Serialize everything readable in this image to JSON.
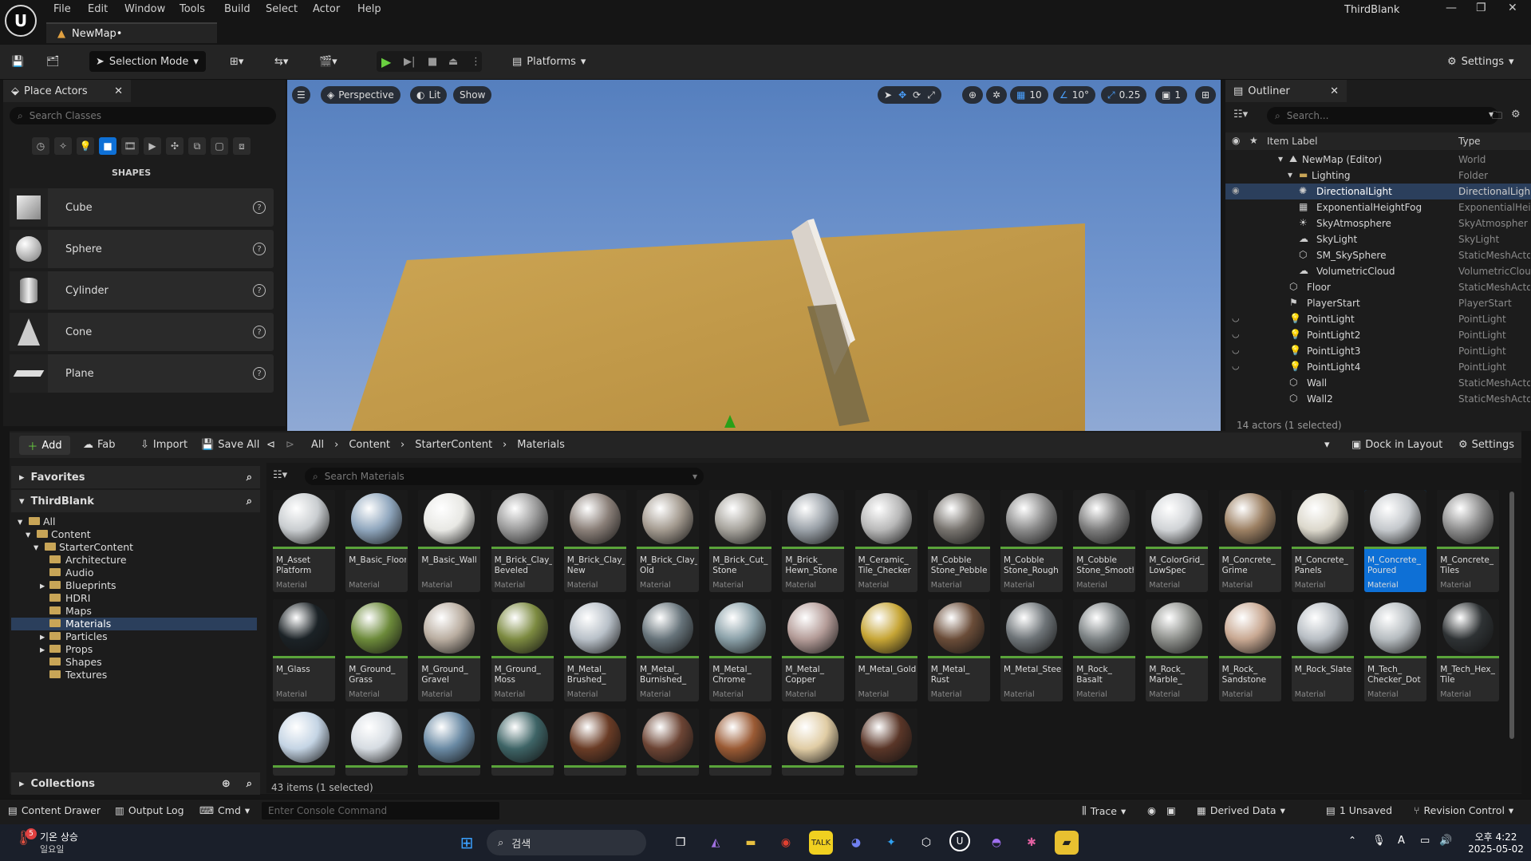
{
  "window": {
    "project": "ThirdBlank",
    "doc_tab": "NewMap•",
    "menus": [
      "File",
      "Edit",
      "Window",
      "Tools",
      "Build",
      "Select",
      "Actor",
      "Help"
    ]
  },
  "toolbar": {
    "selection_mode": "Selection Mode",
    "platforms": "Platforms",
    "settings": "Settings"
  },
  "place_actors": {
    "tab": "Place Actors",
    "search_placeholder": "Search Classes",
    "section": "SHAPES",
    "shapes": [
      "Cube",
      "Sphere",
      "Cylinder",
      "Cone",
      "Plane"
    ]
  },
  "viewport": {
    "perspective": "Perspective",
    "lit": "Lit",
    "show": "Show",
    "grid_snap": "10",
    "rot_snap": "10°",
    "scale_snap": "0.25",
    "camera_speed": "1"
  },
  "outliner": {
    "tab": "Outliner",
    "search_placeholder": "Search...",
    "col_label": "Item Label",
    "col_type": "Type",
    "rows": [
      {
        "label": "NewMap (Editor)",
        "type": "World"
      },
      {
        "label": "Lighting",
        "type": "Folder"
      },
      {
        "label": "DirectionalLight",
        "type": "DirectionalLigh"
      },
      {
        "label": "ExponentialHeightFog",
        "type": "ExponentialHei"
      },
      {
        "label": "SkyAtmosphere",
        "type": "SkyAtmospher"
      },
      {
        "label": "SkyLight",
        "type": "SkyLight"
      },
      {
        "label": "SM_SkySphere",
        "type": "StaticMeshActo"
      },
      {
        "label": "VolumetricCloud",
        "type": "VolumetricClou"
      },
      {
        "label": "Floor",
        "type": "StaticMeshActo"
      },
      {
        "label": "PlayerStart",
        "type": "PlayerStart"
      },
      {
        "label": "PointLight",
        "type": "PointLight"
      },
      {
        "label": "PointLight2",
        "type": "PointLight"
      },
      {
        "label": "PointLight3",
        "type": "PointLight"
      },
      {
        "label": "PointLight4",
        "type": "PointLight"
      },
      {
        "label": "Wall",
        "type": "StaticMeshActo"
      },
      {
        "label": "Wall2",
        "type": "StaticMeshActo"
      }
    ],
    "status": "14 actors (1 selected)"
  },
  "content_browser": {
    "add": "Add",
    "fab": "Fab",
    "import": "Import",
    "save_all": "Save All",
    "breadcrumb": [
      "All",
      "Content",
      "StarterContent",
      "Materials"
    ],
    "dock": "Dock in Layout",
    "settings": "Settings",
    "favorites": "Favorites",
    "project": "ThirdBlank",
    "collections": "Collections",
    "search_placeholder": "Search Materials",
    "tree": [
      {
        "label": "All"
      },
      {
        "label": "Content"
      },
      {
        "label": "StarterContent"
      },
      {
        "label": "Architecture"
      },
      {
        "label": "Audio"
      },
      {
        "label": "Blueprints"
      },
      {
        "label": "HDRI"
      },
      {
        "label": "Maps"
      },
      {
        "label": "Materials"
      },
      {
        "label": "Particles"
      },
      {
        "label": "Props"
      },
      {
        "label": "Shapes"
      },
      {
        "label": "Textures"
      }
    ],
    "asset_type": "Material",
    "assets": [
      {
        "name": "M_Asset\nPlatform",
        "color": "#c9cdd0"
      },
      {
        "name": "M_Basic_Floor",
        "color": "#8fa6bd"
      },
      {
        "name": "M_Basic_Wall",
        "color": "#e8e8e4"
      },
      {
        "name": "M_Brick_Clay_\nBeveled",
        "color": "#9a9a9a"
      },
      {
        "name": "M_Brick_Clay_\nNew",
        "color": "#8a7f78"
      },
      {
        "name": "M_Brick_Clay_\nOld",
        "color": "#a39a8f"
      },
      {
        "name": "M_Brick_Cut_\nStone",
        "color": "#a6a39c"
      },
      {
        "name": "M_Brick_\nHewn_Stone",
        "color": "#9aa1a8"
      },
      {
        "name": "M_Ceramic_\nTile_Checker",
        "color": "#b8b8b8"
      },
      {
        "name": "M_Cobble\nStone_Pebble",
        "color": "#77736e"
      },
      {
        "name": "M_Cobble\nStone_Rough",
        "color": "#8a8a8a"
      },
      {
        "name": "M_Cobble\nStone_Smooth",
        "color": "#7c7c7c"
      },
      {
        "name": "M_ColorGrid_\nLowSpec",
        "color": "#d0d3d6"
      },
      {
        "name": "M_Concrete_\nGrime",
        "color": "#9c8063"
      },
      {
        "name": "M_Concrete_\nPanels",
        "color": "#dcd8cc"
      },
      {
        "name": "M_Concrete_\nPoured",
        "color": "#c4c8cc"
      },
      {
        "name": "M_Concrete_\nTiles",
        "color": "#8c8c8c"
      },
      {
        "name": "M_Glass",
        "color": "#1b2226"
      },
      {
        "name": "M_Ground_\nGrass",
        "color": "#6c8a3a"
      },
      {
        "name": "M_Ground_\nGravel",
        "color": "#b9ada0"
      },
      {
        "name": "M_Ground_\nMoss",
        "color": "#7c8a40"
      },
      {
        "name": "M_Metal_\nBrushed_",
        "color": "#b8c0c8"
      },
      {
        "name": "M_Metal_\nBurnished_",
        "color": "#66737a"
      },
      {
        "name": "M_Metal_\nChrome",
        "color": "#8aa0a8"
      },
      {
        "name": "M_Metal_\nCopper",
        "color": "#b49c98"
      },
      {
        "name": "M_Metal_Gold",
        "color": "#c6a535"
      },
      {
        "name": "M_Metal_\nRust",
        "color": "#6a4c38"
      },
      {
        "name": "M_Metal_Steel",
        "color": "#6e7478"
      },
      {
        "name": "M_Rock_\nBasalt",
        "color": "#7c8284"
      },
      {
        "name": "M_Rock_\nMarble_",
        "color": "#8e908c"
      },
      {
        "name": "M_Rock_\nSandstone",
        "color": "#c8a892"
      },
      {
        "name": "M_Rock_Slate",
        "color": "#b8bec4"
      },
      {
        "name": "M_Tech_\nChecker_Dot",
        "color": "#b6bcc0"
      },
      {
        "name": "M_Tech_Hex_\nTile",
        "color": "#2e3234"
      },
      {
        "name": "",
        "color": "#c4d4e4"
      },
      {
        "name": "",
        "color": "#d6dce2"
      },
      {
        "name": "",
        "color": "#6a8aa4"
      },
      {
        "name": "",
        "color": "#3e6466"
      },
      {
        "name": "",
        "color": "#6a3c26"
      },
      {
        "name": "",
        "color": "#6c4434"
      },
      {
        "name": "",
        "color": "#9a5a34"
      },
      {
        "name": "",
        "color": "#e0cca4"
      },
      {
        "name": "",
        "color": "#5a3628"
      }
    ],
    "status": "43 items (1 selected)"
  },
  "status_bar": {
    "content_drawer": "Content Drawer",
    "output_log": "Output Log",
    "cmd": "Cmd",
    "console_placeholder": "Enter Console Command",
    "trace": "Trace",
    "derived_data": "Derived Data",
    "unsaved": "1 Unsaved",
    "revision_control": "Revision Control"
  },
  "taskbar": {
    "weather_title": "기온 상승",
    "weather_sub": "일요일",
    "weather_badge": "5",
    "search": "검색",
    "time": "오후 4:22",
    "date": "2025-05-02"
  }
}
